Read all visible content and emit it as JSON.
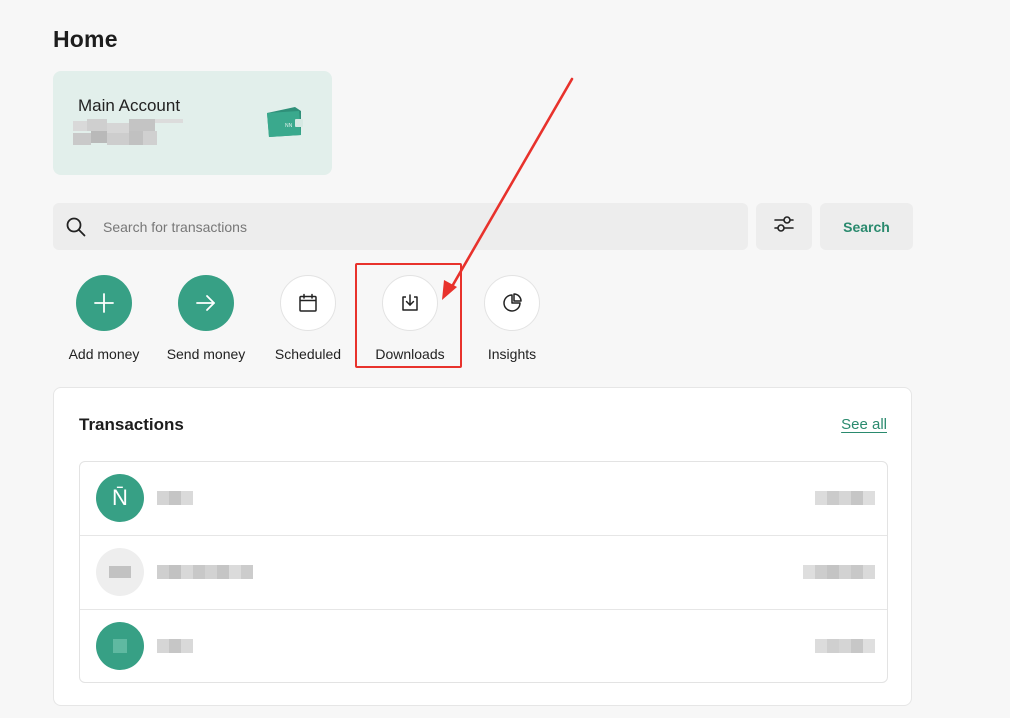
{
  "page": {
    "title": "Home"
  },
  "account_card": {
    "name": "Main Account",
    "wallet_icon": "wallet-icon",
    "wallet_text": "NN"
  },
  "search": {
    "placeholder": "Search for transactions",
    "button_label": "Search",
    "filter_icon": "sliders-icon"
  },
  "actions": [
    {
      "label": "Add money",
      "icon": "plus-icon",
      "style": "filled"
    },
    {
      "label": "Send money",
      "icon": "arrow-right-icon",
      "style": "filled"
    },
    {
      "label": "Scheduled",
      "icon": "calendar-icon",
      "style": "outline"
    },
    {
      "label": "Downloads",
      "icon": "download-icon",
      "style": "outline"
    },
    {
      "label": "Insights",
      "icon": "pie-chart-icon",
      "style": "outline"
    }
  ],
  "transactions": {
    "title": "Transactions",
    "see_all_label": "See all",
    "rows": [
      {
        "avatar_text": "N̄",
        "avatar_color": "#37a085"
      },
      {
        "avatar_text": "",
        "avatar_color": "#eeeeee"
      },
      {
        "avatar_text": "",
        "avatar_color": "#37a085"
      }
    ]
  },
  "colors": {
    "accent": "#37a085",
    "accent_text": "#2a8a6e",
    "card_bg": "#e2efeb",
    "annotation": "#e8322c"
  }
}
